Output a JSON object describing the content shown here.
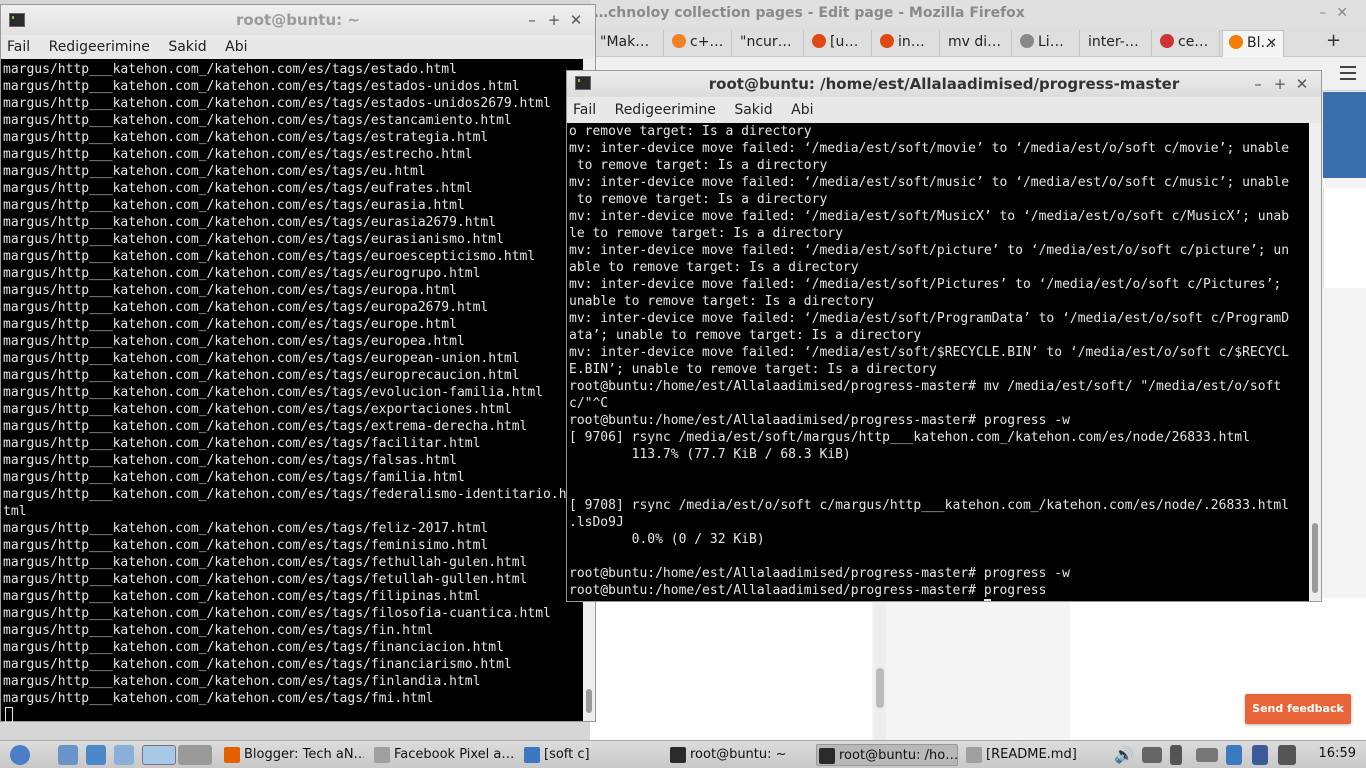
{
  "firefox": {
    "title": "…chnoloy collection pages - Edit page - Mozilla Firefox",
    "tabs": [
      {
        "label": "\"Mak…",
        "icon": "none"
      },
      {
        "label": "c+…",
        "icon": "stackoverflow-icon"
      },
      {
        "label": "\"ncur…",
        "icon": "none"
      },
      {
        "label": "[u…",
        "icon": "ubuntu-icon"
      },
      {
        "label": "in…",
        "icon": "ubuntu-icon"
      },
      {
        "label": "mv di…",
        "icon": "none"
      },
      {
        "label": "Li…",
        "icon": "linux-icon"
      },
      {
        "label": "inter-…",
        "icon": "none"
      },
      {
        "label": "ce…",
        "icon": "chart-icon"
      },
      {
        "label": "Bl…",
        "icon": "blogger-icon"
      }
    ],
    "feedback_button": "Send feedback"
  },
  "left_terminal": {
    "title": "root@buntu: ~",
    "menu": [
      "Fail",
      "Redigeerimine",
      "Sakid",
      "Abi"
    ],
    "lines": [
      "margus/http___katehon.com_/katehon.com/es/tags/estado.html",
      "margus/http___katehon.com_/katehon.com/es/tags/estados-unidos.html",
      "margus/http___katehon.com_/katehon.com/es/tags/estados-unidos2679.html",
      "margus/http___katehon.com_/katehon.com/es/tags/estancamiento.html",
      "margus/http___katehon.com_/katehon.com/es/tags/estrategia.html",
      "margus/http___katehon.com_/katehon.com/es/tags/estrecho.html",
      "margus/http___katehon.com_/katehon.com/es/tags/eu.html",
      "margus/http___katehon.com_/katehon.com/es/tags/eufrates.html",
      "margus/http___katehon.com_/katehon.com/es/tags/eurasia.html",
      "margus/http___katehon.com_/katehon.com/es/tags/eurasia2679.html",
      "margus/http___katehon.com_/katehon.com/es/tags/eurasianismo.html",
      "margus/http___katehon.com_/katehon.com/es/tags/euroescepticismo.html",
      "margus/http___katehon.com_/katehon.com/es/tags/eurogrupo.html",
      "margus/http___katehon.com_/katehon.com/es/tags/europa.html",
      "margus/http___katehon.com_/katehon.com/es/tags/europa2679.html",
      "margus/http___katehon.com_/katehon.com/es/tags/europe.html",
      "margus/http___katehon.com_/katehon.com/es/tags/europea.html",
      "margus/http___katehon.com_/katehon.com/es/tags/european-union.html",
      "margus/http___katehon.com_/katehon.com/es/tags/europrecaucion.html",
      "margus/http___katehon.com_/katehon.com/es/tags/evolucion-familia.html",
      "margus/http___katehon.com_/katehon.com/es/tags/exportaciones.html",
      "margus/http___katehon.com_/katehon.com/es/tags/extrema-derecha.html",
      "margus/http___katehon.com_/katehon.com/es/tags/facilitar.html",
      "margus/http___katehon.com_/katehon.com/es/tags/falsas.html",
      "margus/http___katehon.com_/katehon.com/es/tags/familia.html",
      "margus/http___katehon.com_/katehon.com/es/tags/federalismo-identitario.h",
      "tml",
      "margus/http___katehon.com_/katehon.com/es/tags/feliz-2017.html",
      "margus/http___katehon.com_/katehon.com/es/tags/feminisimo.html",
      "margus/http___katehon.com_/katehon.com/es/tags/fethullah-gulen.html",
      "margus/http___katehon.com_/katehon.com/es/tags/fetullah-gullen.html",
      "margus/http___katehon.com_/katehon.com/es/tags/filipinas.html",
      "margus/http___katehon.com_/katehon.com/es/tags/filosofia-cuantica.html",
      "margus/http___katehon.com_/katehon.com/es/tags/fin.html",
      "margus/http___katehon.com_/katehon.com/es/tags/financiacion.html",
      "margus/http___katehon.com_/katehon.com/es/tags/financiarismo.html",
      "margus/http___katehon.com_/katehon.com/es/tags/finlandia.html",
      "margus/http___katehon.com_/katehon.com/es/tags/fmi.html"
    ]
  },
  "right_terminal": {
    "title": "root@buntu: /home/est/Allalaadimised/progress-master",
    "menu": [
      "Fail",
      "Redigeerimine",
      "Sakid",
      "Abi"
    ],
    "lines": [
      "o remove target: Is a directory",
      "mv: inter-device move failed: ‘/media/est/soft/movie’ to ‘/media/est/o/soft c/movie’; unable",
      " to remove target: Is a directory",
      "mv: inter-device move failed: ‘/media/est/soft/music’ to ‘/media/est/o/soft c/music’; unable",
      " to remove target: Is a directory",
      "mv: inter-device move failed: ‘/media/est/soft/MusicX’ to ‘/media/est/o/soft c/MusicX’; unab",
      "le to remove target: Is a directory",
      "mv: inter-device move failed: ‘/media/est/soft/picture’ to ‘/media/est/o/soft c/picture’; un",
      "able to remove target: Is a directory",
      "mv: inter-device move failed: ‘/media/est/soft/Pictures’ to ‘/media/est/o/soft c/Pictures’;",
      "unable to remove target: Is a directory",
      "mv: inter-device move failed: ‘/media/est/soft/ProgramData’ to ‘/media/est/o/soft c/ProgramD",
      "ata’; unable to remove target: Is a directory",
      "mv: inter-device move failed: ‘/media/est/soft/$RECYCLE.BIN’ to ‘/media/est/o/soft c/$RECYCL",
      "E.BIN’; unable to remove target: Is a directory",
      "root@buntu:/home/est/Allalaadimised/progress-master# mv /media/est/soft/ \"/media/est/o/soft",
      "c/\"^C",
      "root@buntu:/home/est/Allalaadimised/progress-master# progress -w",
      "[ 9706] rsync /media/est/soft/margus/http___katehon.com_/katehon.com/es/node/26833.html",
      "        113.7% (77.7 KiB / 68.3 KiB)",
      "",
      "",
      "[ 9708] rsync /media/est/o/soft c/margus/http___katehon.com_/katehon.com/es/node/.26833.html",
      ".lsDo9J",
      "        0.0% (0 / 32 KiB)",
      "",
      "root@buntu:/home/est/Allalaadimised/progress-master# progress -w",
      "root@buntu:/home/est/Allalaadimised/progress-master# progress"
    ],
    "prompt": "root@buntu:/home/est/Allalaadimised/progress-master# "
  },
  "taskbar": {
    "items": [
      {
        "label": "Blogger: Tech aN…",
        "icon": "firefox-icon",
        "color": "#e66000"
      },
      {
        "label": "Facebook Pixel  a…",
        "icon": "text-editor-icon",
        "color": "#a0a0a0"
      },
      {
        "label": "[soft c]",
        "icon": "folder-icon",
        "color": "#3a78c0"
      },
      {
        "label": "root@buntu: ~",
        "icon": "terminal-icon",
        "color": "#2a2a2a"
      },
      {
        "label": "root@buntu: /ho…",
        "icon": "terminal-icon",
        "color": "#2a2a2a"
      },
      {
        "label": "[README.md]",
        "icon": "text-editor-icon",
        "color": "#a0a0a0"
      }
    ],
    "clock": "16:59"
  }
}
